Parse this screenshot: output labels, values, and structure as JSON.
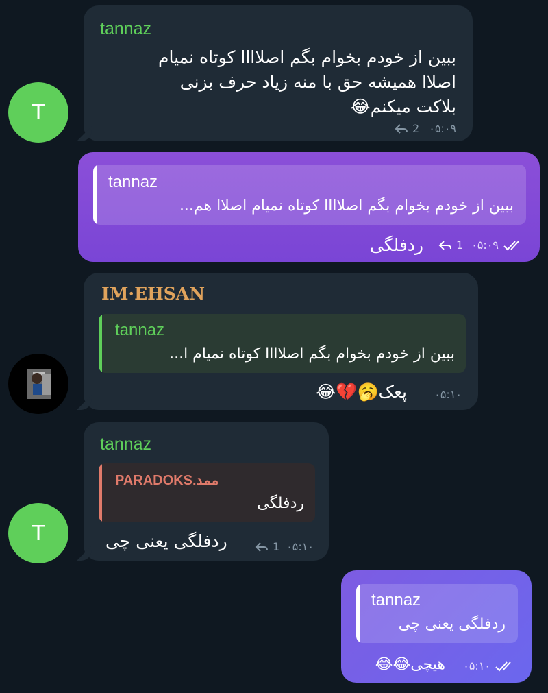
{
  "messages": [
    {
      "sender": "tannaz",
      "avatar_letter": "T",
      "lines": [
        "ببین از خودم بخوام بگم اصلاااا کوتاه نمیام",
        "اصلاا همیشه حق با منه زیاد حرف بزنی",
        "بلاکت میکنم😂"
      ],
      "time": "۰۵:۰۹",
      "reply_count": "2"
    },
    {
      "quote_name": "tannaz",
      "quote_text": "ببین از خودم بخوام بگم اصلاااا کوتاه نمیام اصلاا هم...",
      "text": "ردفلگی",
      "time": "۰۵:۰۹",
      "reply_count": "1"
    },
    {
      "sender": "IM·EHSAN",
      "quote_name": "tannaz",
      "quote_text": "ببین از خودم بخوام بگم اصلاااا کوتاه نمیام ا...",
      "text": "پعک🥱💔😂",
      "time": "۰۵:۱۰"
    },
    {
      "sender": "tannaz",
      "avatar_letter": "T",
      "quote_name": "PARADOKS.ممد",
      "quote_text": "ردفلگی",
      "text": "ردفلگی یعنی چی",
      "time": "۰۵:۱۰",
      "reply_count": "1"
    },
    {
      "quote_name": "tannaz",
      "quote_text": "ردفلگی یعنی چی",
      "text": "هیچی😂😂",
      "time": "۰۵:۱۰"
    }
  ],
  "colors": {
    "background": "#0f1821",
    "incoming_bubble": "#1f2b36",
    "outgoing_bubble": "#7a45d6",
    "name_green": "#5fcf5a",
    "name_gold": "#e0a35c",
    "quote_red": "#e07a6a"
  }
}
